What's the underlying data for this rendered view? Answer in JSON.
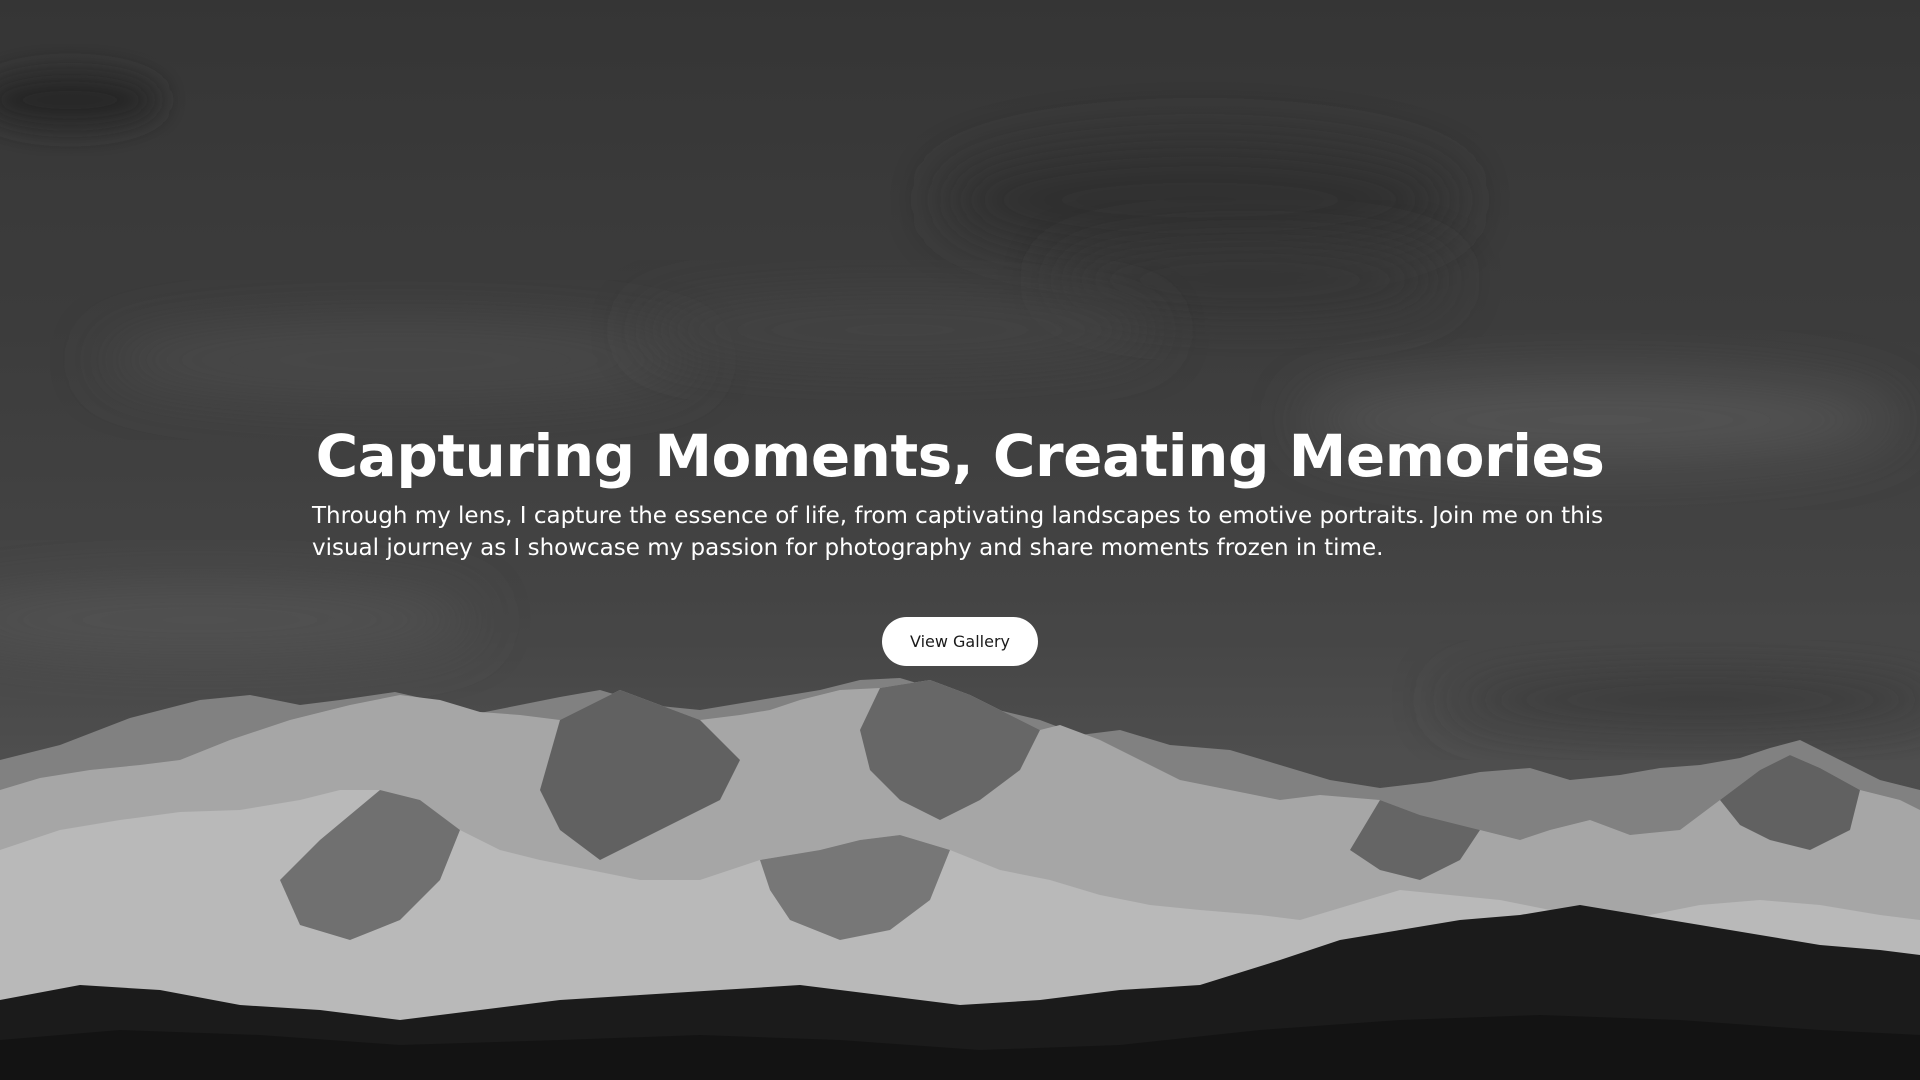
{
  "hero": {
    "headline": "Capturing Moments, Creating Memories",
    "description": "Through my lens, I capture the essence of life, from captivating landscapes to emotive portraits. Join me on this visual journey as I showcase my passion for photography and share moments frozen in time.",
    "cta_label": "View Gallery",
    "background_image": "snowy-mountain-range-grayscale",
    "colors": {
      "text": "#ffffff",
      "button_bg": "#ffffff",
      "button_text": "#1a1a1a",
      "sky": "#424242"
    }
  }
}
